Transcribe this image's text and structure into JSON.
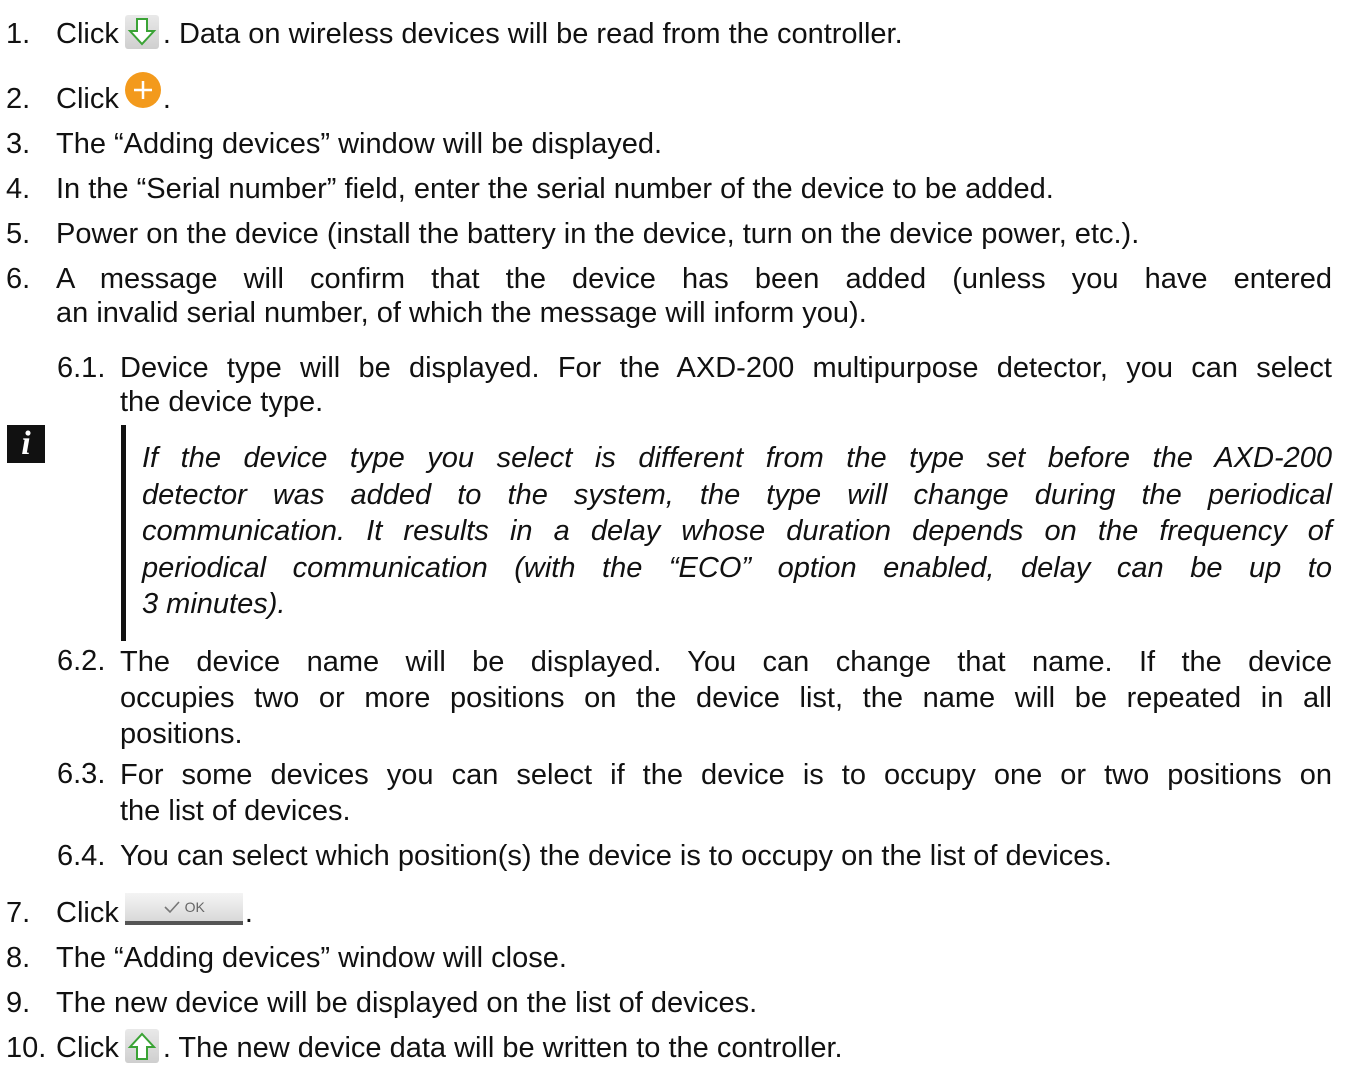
{
  "steps": [
    {
      "num": "1.",
      "pre": "Click",
      "post": ". Data on wireless devices will be read from the controller."
    },
    {
      "num": "2.",
      "pre": "Click",
      "post": "."
    },
    {
      "num": "3.",
      "text": "The “Adding devices” window will be displayed."
    },
    {
      "num": "4.",
      "text": "In the “Serial number” field, enter the serial number of the device to be added."
    },
    {
      "num": "5.",
      "text": "Power on the device (install the battery in the device, turn on the device power, etc.)."
    },
    {
      "num": "6.",
      "line1": "A message will confirm that the device has been added (unless you have entered",
      "line2": "an invalid serial number, of which the message will inform you)."
    },
    {
      "num": "7.",
      "pre": "Click",
      "post": "."
    },
    {
      "num": "8.",
      "text": "The “Adding devices” window will close."
    },
    {
      "num": "9.",
      "text": "The new device will be displayed on the list of devices."
    },
    {
      "num": "10.",
      "pre": "Click",
      "post": ". The new device data will be written to the controller."
    }
  ],
  "substeps": [
    {
      "num": "6.1.",
      "line1": "Device type will be displayed. For the AXD-200 multipurpose detector, you can select",
      "line2": "the device type."
    },
    {
      "num": "6.2.",
      "line1": "The device name will be displayed. You can change that name. If the device",
      "line2": "occupies two or more positions on the device list, the name will be repeated in all",
      "line3": "positions."
    },
    {
      "num": "6.3.",
      "line1": "For some devices you can select if the device is to occupy one or two positions on",
      "line2": "the list of devices."
    },
    {
      "num": "6.4.",
      "line1": "You can select which position(s) the device is to occupy on the list of devices."
    }
  ],
  "note": {
    "icon": "i",
    "lines": [
      "If the device type you select is different from the type set before the AXD-200",
      "detector was added to the system, the type will change during the periodical",
      "communication. It results in a delay whose duration depends on the frequency of",
      "periodical communication (with the “ECO” option enabled, delay can be up to",
      "3 minutes)."
    ]
  },
  "ok_button_label": "OK",
  "icons": {
    "read": "download-arrow-icon",
    "add": "plus-circle-icon",
    "write": "upload-arrow-icon"
  },
  "colors": {
    "accent": "#f39a1c"
  }
}
